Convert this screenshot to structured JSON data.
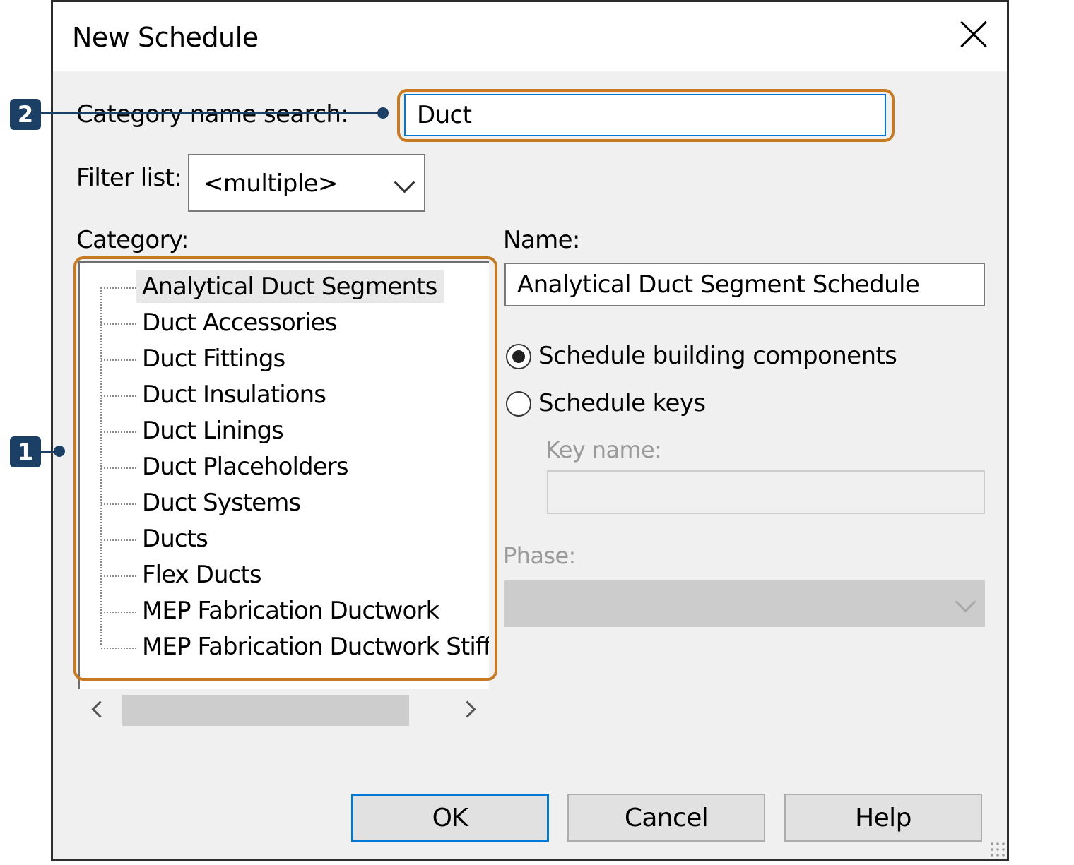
{
  "window": {
    "title": "New Schedule"
  },
  "search": {
    "label": "Category name search:",
    "value": "Duct"
  },
  "filter": {
    "label": "Filter list:",
    "value": "<multiple>"
  },
  "category": {
    "label": "Category:",
    "items": [
      "Analytical Duct Segments",
      "Duct Accessories",
      "Duct Fittings",
      "Duct Insulations",
      "Duct Linings",
      "Duct Placeholders",
      "Duct Systems",
      "Ducts",
      "Flex Ducts",
      "MEP Fabrication Ductwork",
      "MEP Fabrication Ductwork Stiffe"
    ],
    "selected_index": 0
  },
  "name": {
    "label": "Name:",
    "value": "Analytical Duct Segment Schedule"
  },
  "options": {
    "building_components": "Schedule building components",
    "schedule_keys": "Schedule keys",
    "selected": "building_components"
  },
  "key_name": {
    "label": "Key name:",
    "value": ""
  },
  "phase": {
    "label": "Phase:",
    "value": ""
  },
  "buttons": {
    "ok": "OK",
    "cancel": "Cancel",
    "help": "Help"
  },
  "callouts": {
    "one": "1",
    "two": "2"
  },
  "colors": {
    "highlight": "#c87a22",
    "callout": "#1c3f66",
    "focus": "#0078d7"
  }
}
